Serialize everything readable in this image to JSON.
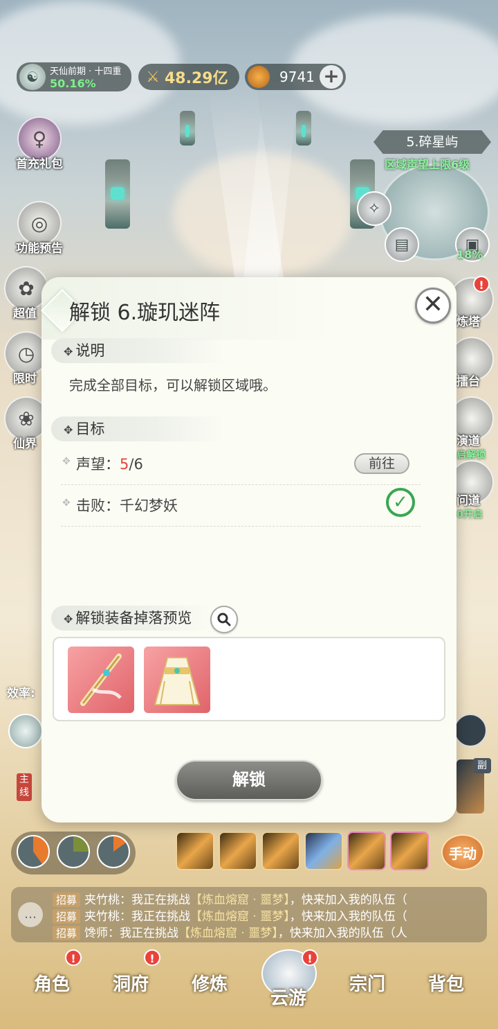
{
  "hud": {
    "realm_name": "天仙前期 · 十四重",
    "realm_progress": "50.16%",
    "combat_power": "48.29亿",
    "currency": "9741",
    "plus_label": "+"
  },
  "left_icons": [
    {
      "label": "首充礼包"
    },
    {
      "label": "功能预告"
    },
    {
      "label": "超值"
    },
    {
      "label": "限时"
    },
    {
      "label": "仙界"
    }
  ],
  "zone": {
    "title": "5.碎星屿",
    "subtitle": "区域声望上限6级",
    "progress": "18%"
  },
  "right_icons": [
    {
      "label": "炼塔"
    },
    {
      "label": "擂台"
    },
    {
      "label": "演道",
      "sub": "启解锁"
    },
    {
      "label": "问道",
      "sub": "0开启"
    }
  ],
  "modal": {
    "title": "解锁 6.璇玑迷阵",
    "close_label": "✕",
    "section_desc_label": "说明",
    "description": "完成全部目标，可以解锁区域哦。",
    "section_goal_label": "目标",
    "goals": [
      {
        "label": "声望：",
        "current": "5",
        "total": "/6",
        "action": "前往"
      },
      {
        "label": "击败：千幻梦妖",
        "completed": true
      }
    ],
    "section_loot_label": "解锁装备掉落预览",
    "loot_items": [
      {
        "icon": "sword-icon"
      },
      {
        "icon": "robe-icon"
      }
    ],
    "unlock_label": "解锁"
  },
  "partial": {
    "efficiency_label": "效率:",
    "main_tag": "主线",
    "side_tag": "副"
  },
  "manual_label": "手动",
  "chat": [
    {
      "tag": "招募",
      "speaker": "夹竹桃：",
      "text_a": "我正在挑战",
      "highlight": "【炼血熔窟 · 噩梦】",
      "text_b": "，快来加入我的队伍（"
    },
    {
      "tag": "招募",
      "speaker": "夹竹桃：",
      "text_a": "我正在挑战",
      "highlight": "【炼血熔窟 · 噩梦】",
      "text_b": "，快来加入我的队伍（"
    },
    {
      "tag": "招募",
      "speaker": "馋师：",
      "text_a": "我正在挑战",
      "highlight": "【炼血熔窟 · 噩梦】",
      "text_b": "，快来加入我的队伍（人"
    }
  ],
  "nav": [
    {
      "label": "角色",
      "badge": "!"
    },
    {
      "label": "洞府",
      "badge": "!"
    },
    {
      "label": "修炼"
    },
    {
      "label": "云游",
      "badge": "!"
    },
    {
      "label": "宗门"
    },
    {
      "label": "背包"
    }
  ],
  "colors": {
    "accent_green": "#3aa653",
    "progress_red": "#e5423b",
    "badge_red": "#e8433b"
  }
}
